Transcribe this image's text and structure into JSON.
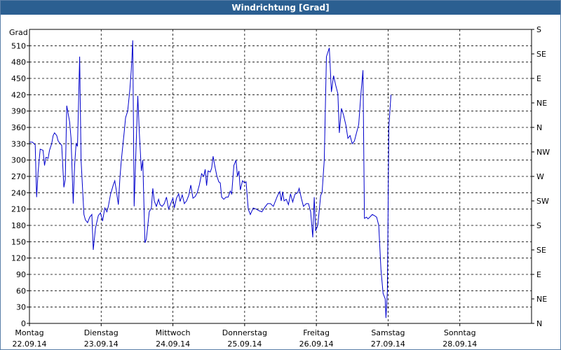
{
  "chart_data": {
    "type": "line",
    "title": "Windrichtung [Grad]",
    "ylabel": "Grad",
    "ylim": [
      0,
      540
    ],
    "yticks": [
      0,
      30,
      60,
      90,
      120,
      150,
      180,
      210,
      240,
      270,
      300,
      330,
      360,
      390,
      420,
      450,
      480,
      510
    ],
    "right_axis_labels": [
      "N",
      "NE",
      "E",
      "SE",
      "S",
      "SW",
      "W",
      "NW",
      "N",
      "NE",
      "E",
      "SE",
      "S"
    ],
    "x_categories": [
      {
        "day": "Montag",
        "date": "22.09.14"
      },
      {
        "day": "Dienstag",
        "date": "23.09.14"
      },
      {
        "day": "Mittwoch",
        "date": "24.09.14"
      },
      {
        "day": "Donnerstag",
        "date": "25.09.14"
      },
      {
        "day": "Freitag",
        "date": "26.09.14"
      },
      {
        "day": "Samstag",
        "date": "27.09.14"
      },
      {
        "day": "Sonntag",
        "date": "28.09.14"
      }
    ],
    "grid": true,
    "line_color": "#0000cc",
    "series": [
      {
        "x_unit": "days since Montag 22.09.14 00:00",
        "points": [
          [
            0.0,
            333
          ],
          [
            0.04,
            333
          ],
          [
            0.08,
            328
          ],
          [
            0.1,
            232
          ],
          [
            0.12,
            278
          ],
          [
            0.15,
            320
          ],
          [
            0.19,
            318
          ],
          [
            0.21,
            290
          ],
          [
            0.23,
            305
          ],
          [
            0.26,
            303
          ],
          [
            0.28,
            318
          ],
          [
            0.31,
            330
          ],
          [
            0.33,
            345
          ],
          [
            0.35,
            350
          ],
          [
            0.38,
            345
          ],
          [
            0.4,
            335
          ],
          [
            0.43,
            330
          ],
          [
            0.45,
            327
          ],
          [
            0.48,
            250
          ],
          [
            0.5,
            265
          ],
          [
            0.52,
            400
          ],
          [
            0.56,
            370
          ],
          [
            0.58,
            340
          ],
          [
            0.61,
            220
          ],
          [
            0.63,
            290
          ],
          [
            0.65,
            330
          ],
          [
            0.67,
            325
          ],
          [
            0.7,
            490
          ],
          [
            0.72,
            300
          ],
          [
            0.76,
            200
          ],
          [
            0.78,
            190
          ],
          [
            0.81,
            185
          ],
          [
            0.84,
            195
          ],
          [
            0.87,
            200
          ],
          [
            0.89,
            135
          ],
          [
            0.92,
            175
          ],
          [
            0.96,
            198
          ],
          [
            0.99,
            203
          ],
          [
            1.02,
            188
          ],
          [
            1.05,
            212
          ],
          [
            1.08,
            205
          ],
          [
            1.1,
            215
          ],
          [
            1.13,
            237
          ],
          [
            1.17,
            255
          ],
          [
            1.19,
            262
          ],
          [
            1.21,
            245
          ],
          [
            1.24,
            218
          ],
          [
            1.26,
            265
          ],
          [
            1.28,
            298
          ],
          [
            1.32,
            350
          ],
          [
            1.34,
            378
          ],
          [
            1.37,
            390
          ],
          [
            1.4,
            430
          ],
          [
            1.42,
            465
          ],
          [
            1.44,
            520
          ],
          [
            1.46,
            215
          ],
          [
            1.48,
            300
          ],
          [
            1.51,
            418
          ],
          [
            1.53,
            355
          ],
          [
            1.56,
            280
          ],
          [
            1.58,
            300
          ],
          [
            1.61,
            148
          ],
          [
            1.63,
            155
          ],
          [
            1.65,
            180
          ],
          [
            1.67,
            205
          ],
          [
            1.7,
            212
          ],
          [
            1.72,
            248
          ],
          [
            1.74,
            225
          ],
          [
            1.77,
            215
          ],
          [
            1.8,
            228
          ],
          [
            1.82,
            218
          ],
          [
            1.85,
            215
          ],
          [
            1.88,
            220
          ],
          [
            1.91,
            232
          ],
          [
            1.94,
            210
          ],
          [
            1.97,
            220
          ],
          [
            2.0,
            230
          ],
          [
            2.02,
            212
          ],
          [
            2.05,
            230
          ],
          [
            2.08,
            238
          ],
          [
            2.1,
            224
          ],
          [
            2.13,
            236
          ],
          [
            2.16,
            220
          ],
          [
            2.19,
            225
          ],
          [
            2.22,
            235
          ],
          [
            2.25,
            254
          ],
          [
            2.28,
            230
          ],
          [
            2.31,
            233
          ],
          [
            2.34,
            240
          ],
          [
            2.37,
            255
          ],
          [
            2.4,
            275
          ],
          [
            2.43,
            270
          ],
          [
            2.45,
            283
          ],
          [
            2.47,
            253
          ],
          [
            2.49,
            280
          ],
          [
            2.52,
            278
          ],
          [
            2.54,
            285
          ],
          [
            2.56,
            307
          ],
          [
            2.58,
            292
          ],
          [
            2.61,
            272
          ],
          [
            2.64,
            260
          ],
          [
            2.66,
            258
          ],
          [
            2.68,
            232
          ],
          [
            2.71,
            228
          ],
          [
            2.74,
            232
          ],
          [
            2.77,
            232
          ],
          [
            2.8,
            243
          ],
          [
            2.82,
            238
          ],
          [
            2.85,
            290
          ],
          [
            2.88,
            300
          ],
          [
            2.9,
            270
          ],
          [
            2.92,
            280
          ],
          [
            2.94,
            245
          ],
          [
            2.97,
            262
          ],
          [
            3.0,
            258
          ],
          [
            3.02,
            260
          ],
          [
            3.05,
            210
          ],
          [
            3.08,
            200
          ],
          [
            3.12,
            212
          ],
          [
            3.16,
            210
          ],
          [
            3.2,
            207
          ],
          [
            3.24,
            205
          ],
          [
            3.28,
            213
          ],
          [
            3.32,
            220
          ],
          [
            3.36,
            220
          ],
          [
            3.4,
            215
          ],
          [
            3.43,
            225
          ],
          [
            3.46,
            235
          ],
          [
            3.49,
            242
          ],
          [
            3.51,
            225
          ],
          [
            3.53,
            242
          ],
          [
            3.55,
            225
          ],
          [
            3.58,
            228
          ],
          [
            3.61,
            218
          ],
          [
            3.64,
            238
          ],
          [
            3.67,
            223
          ],
          [
            3.7,
            237
          ],
          [
            3.74,
            240
          ],
          [
            3.76,
            248
          ],
          [
            3.79,
            230
          ],
          [
            3.82,
            215
          ],
          [
            3.86,
            220
          ],
          [
            3.89,
            220
          ],
          [
            3.92,
            205
          ],
          [
            3.95,
            158
          ],
          [
            3.97,
            232
          ],
          [
            3.99,
            170
          ],
          [
            4.02,
            180
          ],
          [
            4.06,
            235
          ],
          [
            4.08,
            240
          ],
          [
            4.11,
            300
          ],
          [
            4.14,
            490
          ],
          [
            4.18,
            506
          ],
          [
            4.21,
            425
          ],
          [
            4.24,
            455
          ],
          [
            4.27,
            437
          ],
          [
            4.3,
            422
          ],
          [
            4.32,
            350
          ],
          [
            4.35,
            395
          ],
          [
            4.38,
            382
          ],
          [
            4.41,
            365
          ],
          [
            4.44,
            340
          ],
          [
            4.47,
            345
          ],
          [
            4.5,
            330
          ],
          [
            4.53,
            335
          ],
          [
            4.56,
            350
          ],
          [
            4.59,
            365
          ],
          [
            4.62,
            420
          ],
          [
            4.65,
            465
          ],
          [
            4.67,
            193
          ],
          [
            4.7,
            195
          ],
          [
            4.72,
            192
          ],
          [
            4.75,
            196
          ],
          [
            4.78,
            200
          ],
          [
            4.81,
            198
          ],
          [
            4.84,
            195
          ],
          [
            4.87,
            180
          ],
          [
            4.9,
            100
          ],
          [
            4.93,
            55
          ],
          [
            4.96,
            45
          ],
          [
            4.97,
            10
          ],
          [
            4.99,
            60
          ],
          [
            5.01,
            360
          ],
          [
            5.04,
            420
          ]
        ]
      }
    ]
  }
}
